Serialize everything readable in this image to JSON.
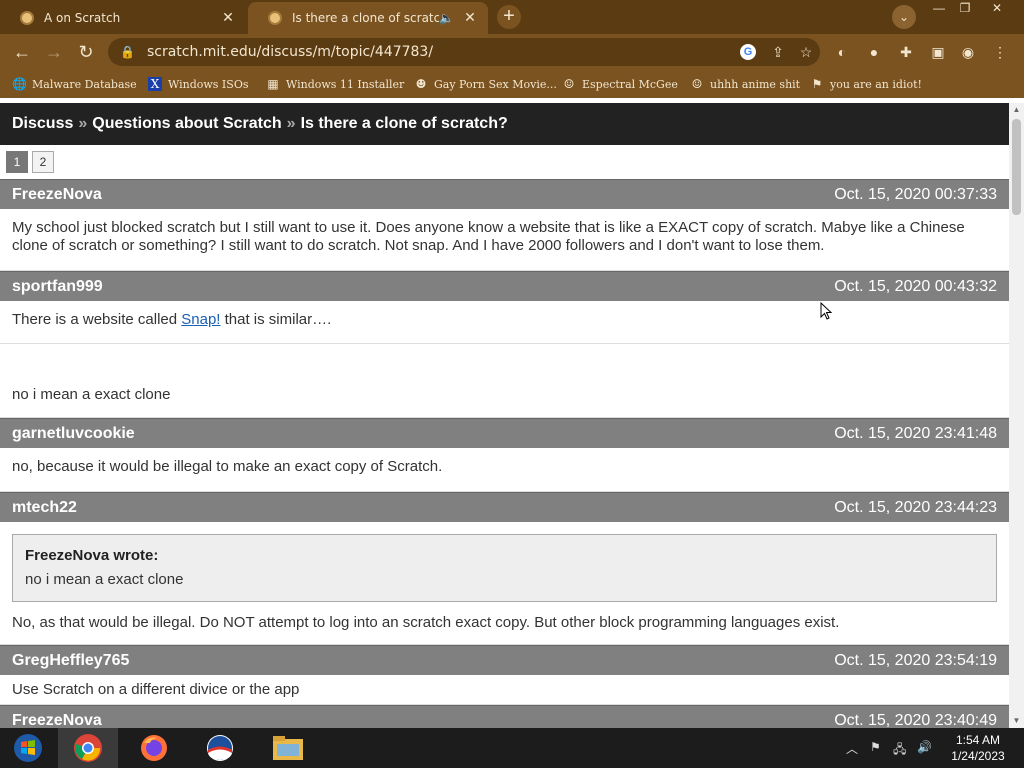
{
  "browser": {
    "tabs": [
      {
        "title": "A on Scratch",
        "active": false
      },
      {
        "title": "Is there a clone of scratch?",
        "active": true
      }
    ],
    "url": "scratch.mit.edu/discuss/m/topic/447783/",
    "bookmarks": [
      {
        "label": "Malware Database",
        "icon": "globe-icon"
      },
      {
        "label": "Windows ISOs",
        "icon": "x-logo-icon"
      },
      {
        "label": "Windows 11 Installer",
        "icon": "image-icon"
      },
      {
        "label": "Gay Porn Sex Movie...",
        "icon": "site-icon"
      },
      {
        "label": "Espectral McGee",
        "icon": "avatar-icon"
      },
      {
        "label": "uhhh anime shit",
        "icon": "avatar-icon"
      },
      {
        "label": "you are an idiot!",
        "icon": "flag-icon"
      }
    ]
  },
  "page": {
    "breadcrumb": [
      "Discuss",
      "Questions about Scratch",
      "Is there a clone of scratch?"
    ],
    "breadcrumb_sep": "»",
    "pages": [
      "1",
      "2"
    ],
    "current_page": "1"
  },
  "posts": [
    {
      "author": "FreezeNova",
      "date": "Oct. 15, 2020 00:37:33",
      "body": "My school just blocked scratch but I still want to use it. Does anyone know a website that is like a EXACT copy of scratch. Mabye like a Chinese clone of scratch or something? I still want to do scratch. Not snap. And I have 2000 followers and I don't want to lose them."
    },
    {
      "author": "sportfan999",
      "date": "Oct. 15, 2020 00:43:32",
      "body_before": "There is a website called ",
      "link": "Snap!",
      "body_after": " that is similar….",
      "body2": "no i mean a exact clone"
    },
    {
      "author": "garnetluvcookie",
      "date": "Oct. 15, 2020 23:41:48",
      "body": "no, because it would be illegal to make an exact copy of Scratch."
    },
    {
      "author": "mtech22",
      "date": "Oct. 15, 2020 23:44:23",
      "quote_author": "FreezeNova wrote:",
      "quote_text": "no i mean a exact clone",
      "body": "No, as that would be illegal. Do NOT attempt to log into an scratch exact copy. But other block programming languages exist."
    },
    {
      "author": "GregHeffley765",
      "date": "Oct. 15, 2020 23:54:19",
      "body": "Use Scratch on a different divice or the app"
    },
    {
      "author": "FreezeNova",
      "date": "Oct. 15, 2020 23:40:49"
    }
  ],
  "taskbar": {
    "apps": [
      "start-button",
      "chrome-icon",
      "firefox-icon",
      "obama-logo-icon",
      "file-explorer-icon"
    ],
    "time": "1:54 AM",
    "date": "1/24/2023"
  },
  "colors": {
    "tab_bar": "#5b3b12",
    "toolbar": "#7a5320",
    "post_header": "#808080",
    "link": "#1a5fb4"
  }
}
